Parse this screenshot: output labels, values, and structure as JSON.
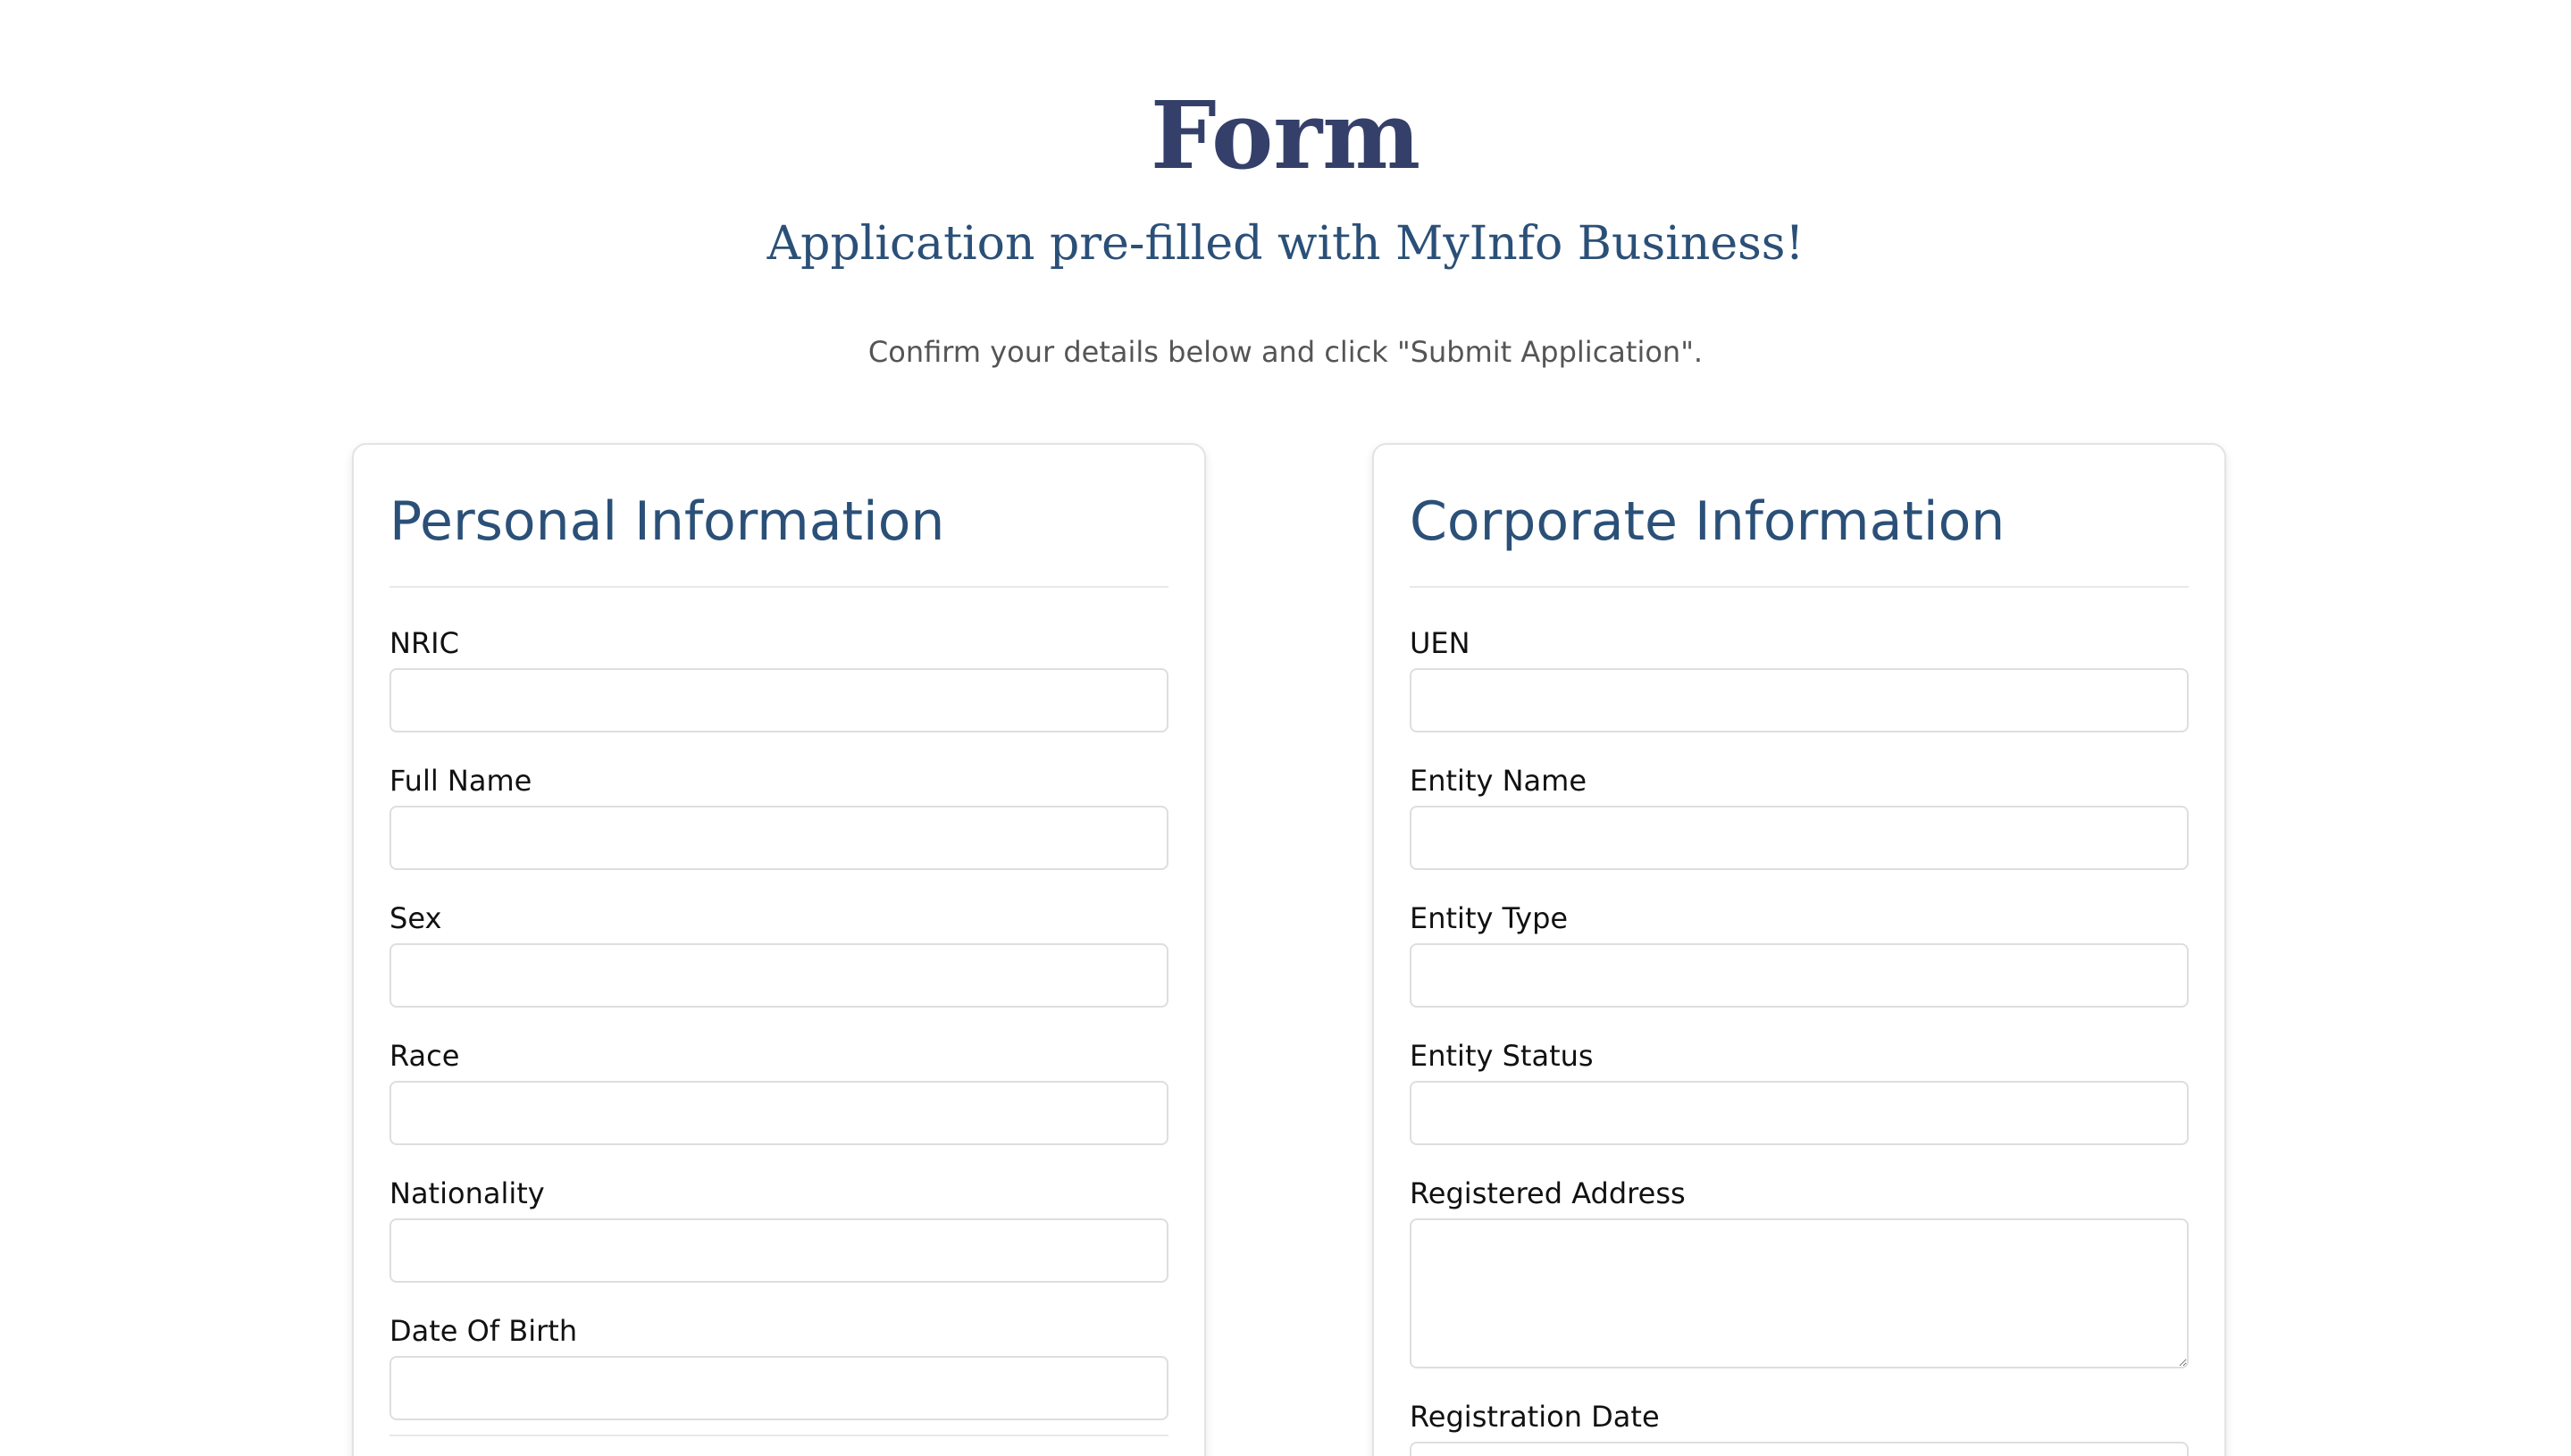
{
  "header": {
    "title": "Form",
    "subtitle": "Application pre-filled with MyInfo Business!",
    "instructions": "Confirm your details below and click \"Submit Application\"."
  },
  "personal": {
    "title": "Personal Information",
    "fields": [
      {
        "label": "NRIC",
        "value": "",
        "placeholder": ""
      },
      {
        "label": "Full Name",
        "value": "",
        "placeholder": ""
      },
      {
        "label": "Sex",
        "value": "",
        "placeholder": ""
      },
      {
        "label": "Race",
        "value": "",
        "placeholder": ""
      },
      {
        "label": "Nationality",
        "value": "",
        "placeholder": ""
      },
      {
        "label": "Date Of Birth",
        "value": "",
        "placeholder": ""
      }
    ]
  },
  "corporate": {
    "title": "Corporate Information",
    "fields": [
      {
        "label": "UEN",
        "value": "",
        "placeholder": ""
      },
      {
        "label": "Entity Name",
        "value": "",
        "placeholder": ""
      },
      {
        "label": "Entity Type",
        "value": "",
        "placeholder": ""
      },
      {
        "label": "Entity Status",
        "value": "",
        "placeholder": ""
      },
      {
        "label": "Registered Address",
        "value": "",
        "placeholder": ""
      },
      {
        "label": "Registration Date",
        "value": "",
        "placeholder": ""
      }
    ]
  },
  "colors": {
    "title": "#35406a",
    "subtitle": "#2b5078",
    "card_heading": "#2b5078",
    "instructions": "#555555",
    "border": "#dedede"
  }
}
